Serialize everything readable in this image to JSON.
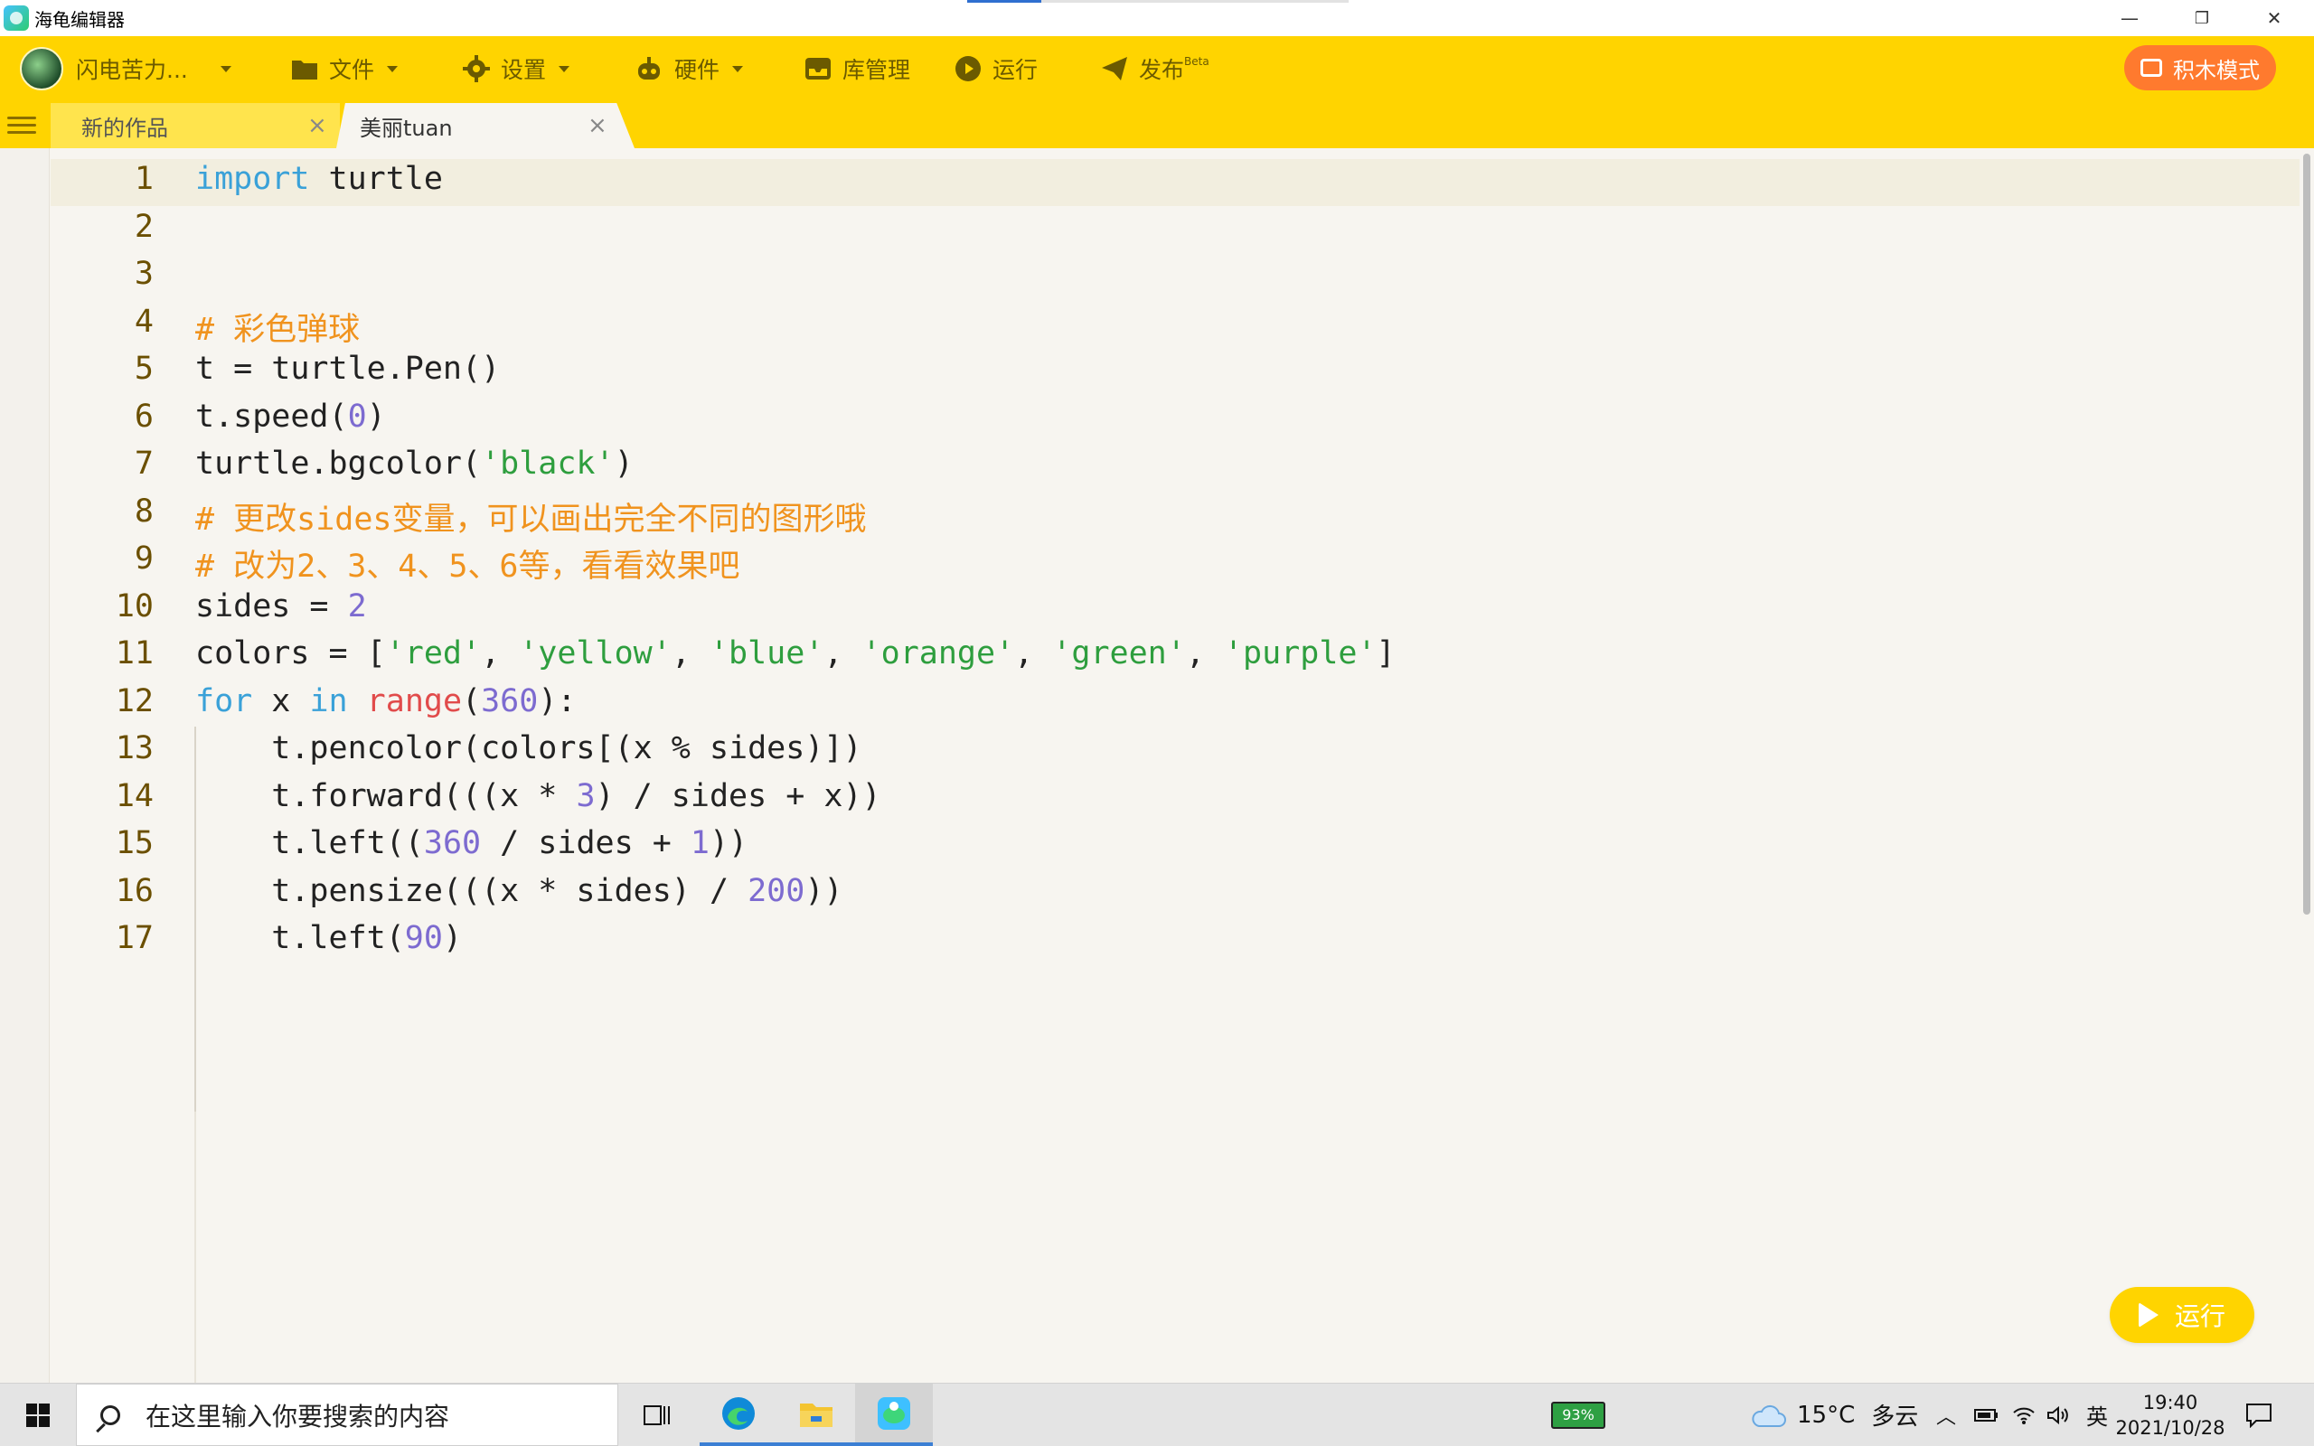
{
  "window": {
    "title": "海龟编辑器",
    "minimize": "—",
    "restore": "❐",
    "close": "✕"
  },
  "toolbar": {
    "user": "闪电苦力...",
    "file": "文件",
    "settings": "设置",
    "hardware": "硬件",
    "library": "库管理",
    "run": "运行",
    "publish": "发布",
    "publish_badge": "Beta",
    "block_mode": "积木模式"
  },
  "tabs": [
    {
      "label": "新的作品",
      "close": "×"
    },
    {
      "label": "美丽tuan",
      "close": "×"
    }
  ],
  "editor": {
    "line_numbers": [
      "1",
      "2",
      "3",
      "4",
      "5",
      "6",
      "7",
      "8",
      "9",
      "10",
      "11",
      "12",
      "13",
      "14",
      "15",
      "16",
      "17"
    ],
    "lines": [
      "import turtle",
      "",
      "",
      "# 彩色弹球",
      "t = turtle.Pen()",
      "t.speed(0)",
      "turtle.bgcolor('black')",
      "# 更改sides变量，可以画出完全不同的图形哦",
      "# 改为2、3、4、5、6等，看看效果吧",
      "sides = 2",
      "colors = ['red', 'yellow', 'blue', 'orange', 'green', 'purple']",
      "for x in range(360):",
      "    t.pencolor(colors[(x % sides)])",
      "    t.forward(((x * 3) / sides + x))",
      "    t.left((360 / sides + 1))",
      "    t.pensize(((x * sides) / 200))",
      "    t.left(90)"
    ]
  },
  "run_button": {
    "label": "运行"
  },
  "taskbar": {
    "search_placeholder": "在这里输入你要搜索的内容",
    "battery": "93%",
    "weather_temp": "15°C",
    "weather_desc": "多云",
    "ime": "英",
    "time": "19:40",
    "date": "2021/10/28"
  },
  "colors": {
    "toolbar": "#ffd400",
    "block_mode_button": "#ff7a2e",
    "keyword": "#3aa1d8",
    "string": "#2e9e3e",
    "number": "#7d6bd0",
    "comment": "#f0931e",
    "builtin": "#e14b4b"
  }
}
